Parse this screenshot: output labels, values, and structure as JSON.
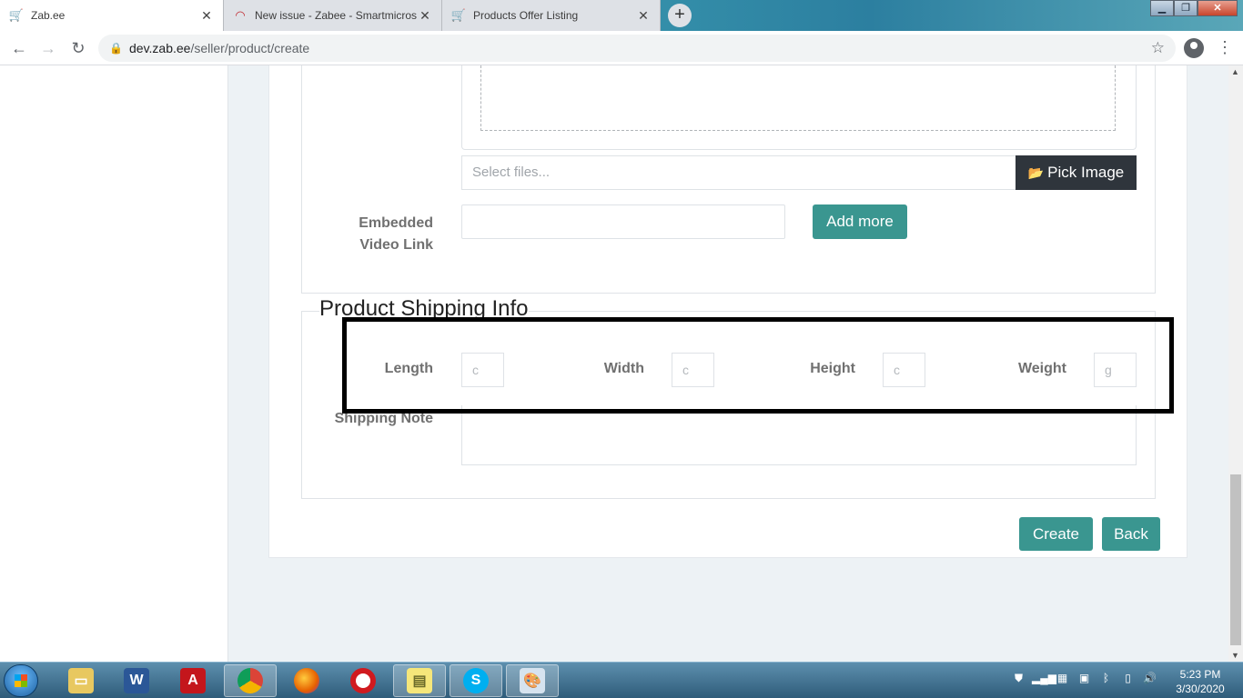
{
  "browser": {
    "tabs": [
      {
        "title": "Zab.ee",
        "active": true
      },
      {
        "title": "New issue - Zabee - Smartmicros",
        "active": false
      },
      {
        "title": "Products Offer Listing",
        "active": false
      }
    ],
    "new_tab_label": "+",
    "url_host": "dev.zab.ee",
    "url_path": "/seller/product/create"
  },
  "form": {
    "file_placeholder": "Select files...",
    "pick_image_label": "Pick Image",
    "embedded_video_label_line1": "Embedded",
    "embedded_video_label_line2": "Video Link",
    "add_more_label": "Add more",
    "shipping_legend": "Product Shipping Info",
    "shipping_fields": [
      {
        "label": "Length",
        "placeholder": "c"
      },
      {
        "label": "Width",
        "placeholder": "c"
      },
      {
        "label": "Height",
        "placeholder": "c"
      },
      {
        "label": "Weight",
        "placeholder": "g"
      }
    ],
    "shipping_note_label": "Shipping Note",
    "create_label": "Create",
    "back_label": "Back"
  },
  "taskbar": {
    "time": "5:23 PM",
    "date": "3/30/2020",
    "apps": [
      "explorer",
      "word",
      "acrobat",
      "chrome",
      "firefox",
      "opera",
      "sticky-notes",
      "skype",
      "paint"
    ]
  },
  "colors": {
    "teal_button": "#3a9690",
    "dark_button": "#2f353c",
    "page_background": "#edf2f5"
  }
}
